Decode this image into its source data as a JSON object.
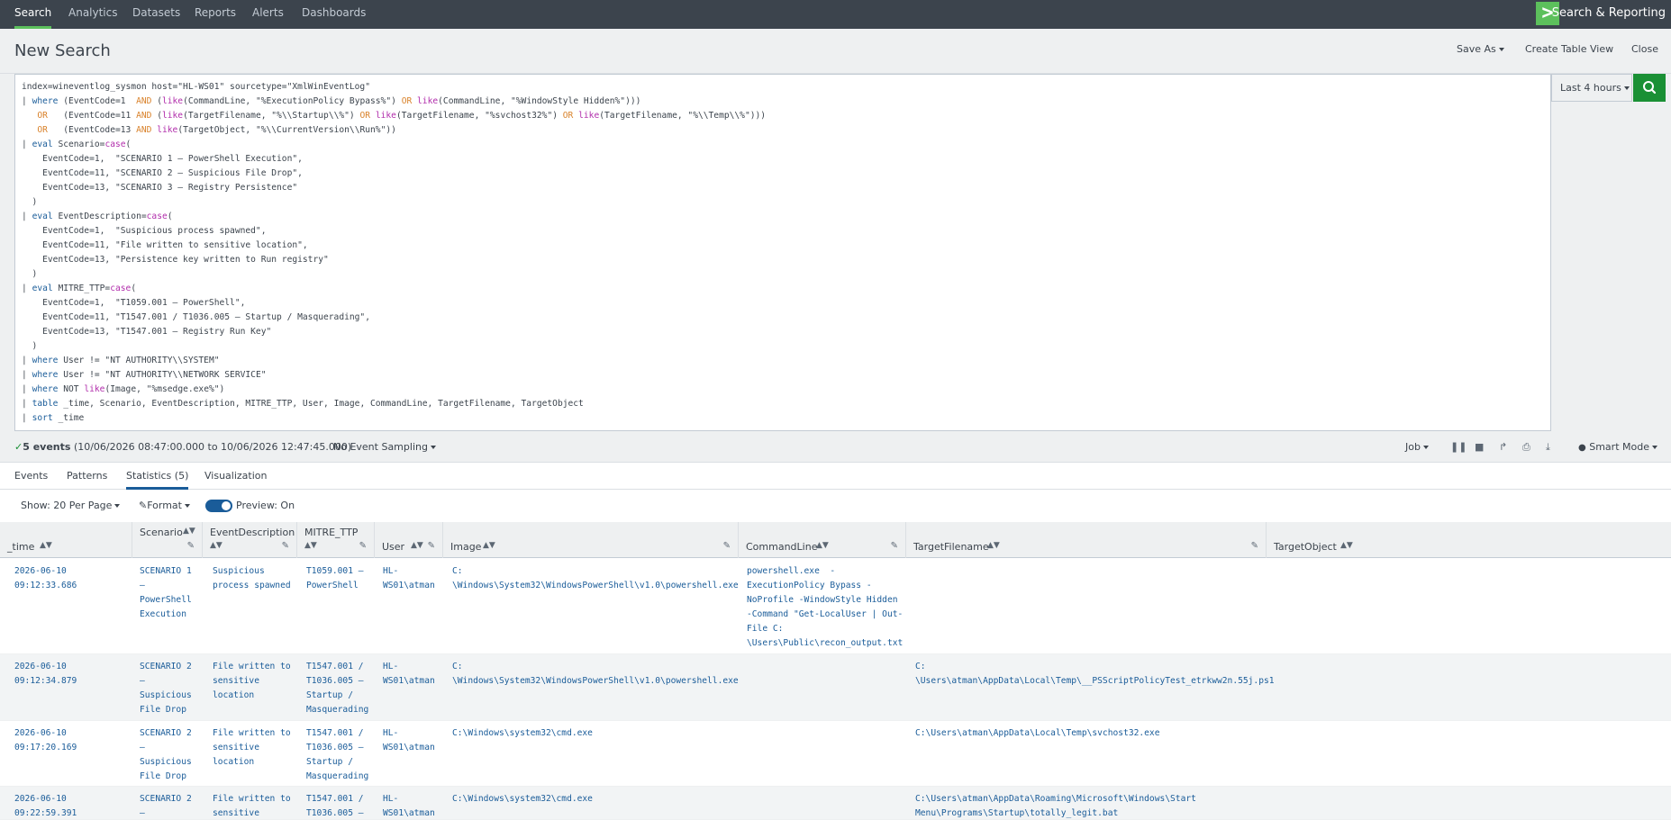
{
  "nav": {
    "tabs": [
      "Search",
      "Analytics",
      "Datasets",
      "Reports",
      "Alerts",
      "Dashboards"
    ],
    "brand_name": "Search & Reporting"
  },
  "header": {
    "title": "New Search",
    "save_as": "Save As",
    "create_table_view": "Create Table View",
    "close": "Close"
  },
  "query": {
    "lines": [
      "index=wineventlog_sysmon host=\"HL-WS01\" sourcetype=\"XmlWinEventLog\"",
      "| where (EventCode=1  AND (like(CommandLine, \"%ExecutionPolicy Bypass%\") OR like(CommandLine, \"%WindowStyle Hidden%\")))",
      "   OR   (EventCode=11 AND (like(TargetFilename, \"%\\\\Startup\\\\%\") OR like(TargetFilename, \"%svchost32%\") OR like(TargetFilename, \"%\\\\Temp\\\\%\")))",
      "   OR   (EventCode=13 AND like(TargetObject, \"%\\\\CurrentVersion\\\\Run%\"))",
      "| eval Scenario=case(",
      "    EventCode=1,  \"SCENARIO 1 — PowerShell Execution\",",
      "    EventCode=11, \"SCENARIO 2 — Suspicious File Drop\",",
      "    EventCode=13, \"SCENARIO 3 — Registry Persistence\"",
      "  )",
      "| eval EventDescription=case(",
      "    EventCode=1,  \"Suspicious process spawned\",",
      "    EventCode=11, \"File written to sensitive location\",",
      "    EventCode=13, \"Persistence key written to Run registry\"",
      "  )",
      "| eval MITRE_TTP=case(",
      "    EventCode=1,  \"T1059.001 — PowerShell\",",
      "    EventCode=11, \"T1547.001 / T1036.005 — Startup / Masquerading\",",
      "    EventCode=13, \"T1547.001 — Registry Run Key\"",
      "  )",
      "| where User != \"NT AUTHORITY\\\\SYSTEM\"",
      "| where User != \"NT AUTHORITY\\\\NETWORK SERVICE\"",
      "| where NOT like(Image, \"%msedge.exe%\")",
      "| table _time, Scenario, EventDescription, MITRE_TTP, User, Image, CommandLine, TargetFilename, TargetObject",
      "| sort _time"
    ],
    "time_range": "Last 4 hours"
  },
  "status": {
    "check": "✓",
    "count": "5 events",
    "range": "(10/06/2026 08:47:00.000 to 10/06/2026 12:47:45.000)",
    "sampling": "No Event Sampling",
    "job": "Job",
    "mode": "Smart Mode"
  },
  "tabs": [
    "Events",
    "Patterns",
    "Statistics (5)",
    "Visualization"
  ],
  "toolbar": {
    "show": "Show: 20 Per Page",
    "format": "Format",
    "preview": "Preview: On"
  },
  "table": {
    "columns": [
      "_time",
      "Scenario",
      "EventDescription",
      "MITRE_TTP",
      "User",
      "Image",
      "CommandLine",
      "TargetFilename",
      "TargetObject"
    ],
    "rows": [
      {
        "time": "2026-06-10\n09:12:33.686",
        "scenario": "SCENARIO 1\n—\nPowerShell\nExecution",
        "desc": "Suspicious\nprocess spawned",
        "ttp": "T1059.001 —\nPowerShell",
        "user": "HL-\nWS01\\atman",
        "image": "C:\n\\Windows\\System32\\WindowsPowerShell\\v1.0\\powershell.exe",
        "cmd": "powershell.exe  -\nExecutionPolicy Bypass -\nNoProfile -WindowStyle Hidden\n-Command \"Get-LocalUser | Out-\nFile C:\n\\Users\\Public\\recon_output.txt",
        "target": "",
        "obj": ""
      },
      {
        "time": "2026-06-10\n09:12:34.879",
        "scenario": "SCENARIO 2\n—\nSuspicious\nFile Drop",
        "desc": "File written to\nsensitive\nlocation",
        "ttp": "T1547.001 /\nT1036.005 —\nStartup /\nMasquerading",
        "user": "HL-\nWS01\\atman",
        "image": "C:\n\\Windows\\System32\\WindowsPowerShell\\v1.0\\powershell.exe",
        "cmd": "",
        "target": "C:\n\\Users\\atman\\AppData\\Local\\Temp\\__PSScriptPolicyTest_etrkww2n.55j.ps1",
        "obj": ""
      },
      {
        "time": "2026-06-10\n09:17:20.169",
        "scenario": "SCENARIO 2\n—\nSuspicious\nFile Drop",
        "desc": "File written to\nsensitive\nlocation",
        "ttp": "T1547.001 /\nT1036.005 —\nStartup /\nMasquerading",
        "user": "HL-\nWS01\\atman",
        "image": "C:\\Windows\\system32\\cmd.exe",
        "cmd": "",
        "target": "C:\\Users\\atman\\AppData\\Local\\Temp\\svchost32.exe",
        "obj": ""
      },
      {
        "time": "2026-06-10\n09:22:59.391",
        "scenario": "SCENARIO 2\n—",
        "desc": "File written to\nsensitive",
        "ttp": "T1547.001 /\nT1036.005 —",
        "user": "HL-\nWS01\\atman",
        "image": "C:\\Windows\\system32\\cmd.exe",
        "cmd": "",
        "target": "C:\\Users\\atman\\AppData\\Roaming\\Microsoft\\Windows\\Start\nMenu\\Programs\\Startup\\totally_legit.bat",
        "obj": ""
      }
    ]
  }
}
